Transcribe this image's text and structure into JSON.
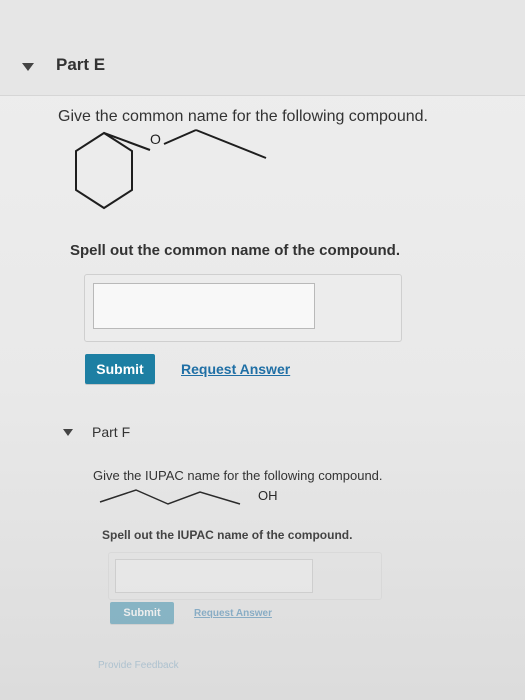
{
  "partE": {
    "title": "Part E",
    "question": "Give the common name for the following compound.",
    "molecule_label": "O",
    "instruction": "Spell out the common name of the compound.",
    "answer_value": "",
    "submit_label": "Submit",
    "request_label": "Request Answer"
  },
  "partF": {
    "title": "Part F",
    "question": "Give the IUPAC name for the following compound.",
    "molecule_label": "OH",
    "instruction": "Spell out the IUPAC name of the compound.",
    "answer_value": "",
    "submit_label": "Submit",
    "request_label": "Request Answer"
  },
  "footer": {
    "feedback_label": "Provide Feedback"
  },
  "colors": {
    "accent": "#1d7fa3",
    "link": "#1f6fa5"
  },
  "icons": {
    "section_toggle": "caret-down-icon"
  }
}
